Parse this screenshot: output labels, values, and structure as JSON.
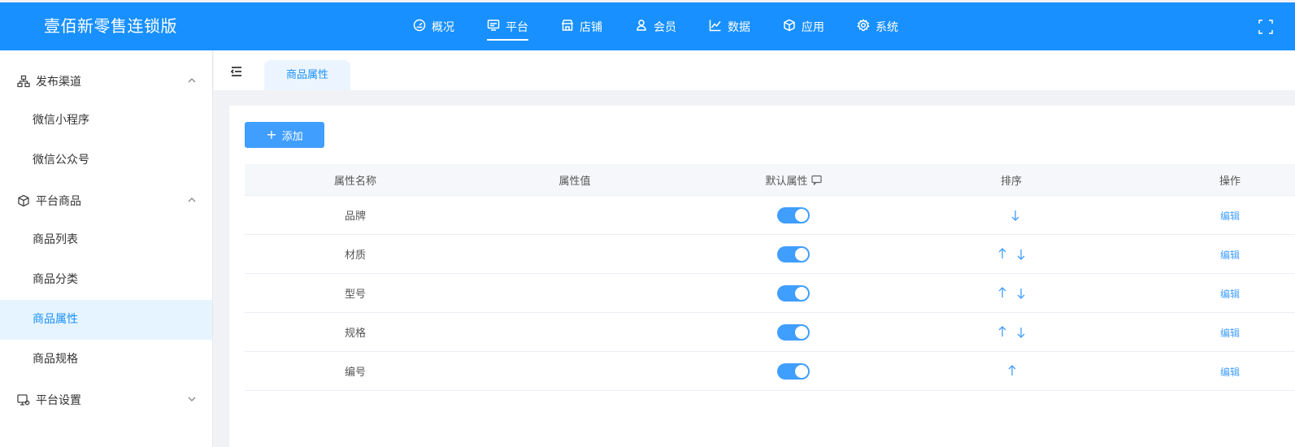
{
  "header": {
    "brand": "壹佰新零售连锁版",
    "nav": [
      {
        "label": "概况",
        "icon": "dashboard-icon"
      },
      {
        "label": "平台",
        "icon": "monitor-icon",
        "active": true
      },
      {
        "label": "店铺",
        "icon": "store-icon"
      },
      {
        "label": "会员",
        "icon": "user-icon"
      },
      {
        "label": "数据",
        "icon": "chart-icon"
      },
      {
        "label": "应用",
        "icon": "cube-icon"
      },
      {
        "label": "系统",
        "icon": "gear-icon"
      }
    ]
  },
  "sidebar": {
    "groups": [
      {
        "label": "发布渠道",
        "icon": "sitemap-icon",
        "expanded": true,
        "items": [
          {
            "label": "微信小程序"
          },
          {
            "label": "微信公众号"
          }
        ]
      },
      {
        "label": "平台商品",
        "icon": "box-icon",
        "expanded": true,
        "items": [
          {
            "label": "商品列表"
          },
          {
            "label": "商品分类"
          },
          {
            "label": "商品属性",
            "active": true
          },
          {
            "label": "商品规格"
          }
        ]
      },
      {
        "label": "平台设置",
        "icon": "monitor-gear-icon",
        "expanded": false,
        "items": []
      }
    ]
  },
  "tabs": [
    {
      "label": "商品属性",
      "active": true
    }
  ],
  "toolbar": {
    "add_label": "添加"
  },
  "table": {
    "columns": {
      "name": "属性名称",
      "value": "属性值",
      "default": "默认属性",
      "sort": "排序",
      "op": "操作"
    },
    "rows": [
      {
        "name": "品牌",
        "value": "",
        "default_on": true,
        "sort": [
          "down"
        ],
        "edit": "编辑"
      },
      {
        "name": "材质",
        "value": "",
        "default_on": true,
        "sort": [
          "up",
          "down"
        ],
        "edit": "编辑"
      },
      {
        "name": "型号",
        "value": "",
        "default_on": true,
        "sort": [
          "up",
          "down"
        ],
        "edit": "编辑"
      },
      {
        "name": "规格",
        "value": "",
        "default_on": true,
        "sort": [
          "up",
          "down"
        ],
        "edit": "编辑"
      },
      {
        "name": "编号",
        "value": "",
        "default_on": true,
        "sort": [
          "up"
        ],
        "edit": "编辑"
      }
    ]
  },
  "colors": {
    "primary": "#1890ff",
    "switch": "#409eff",
    "active_bg": "#e6f4ff"
  }
}
